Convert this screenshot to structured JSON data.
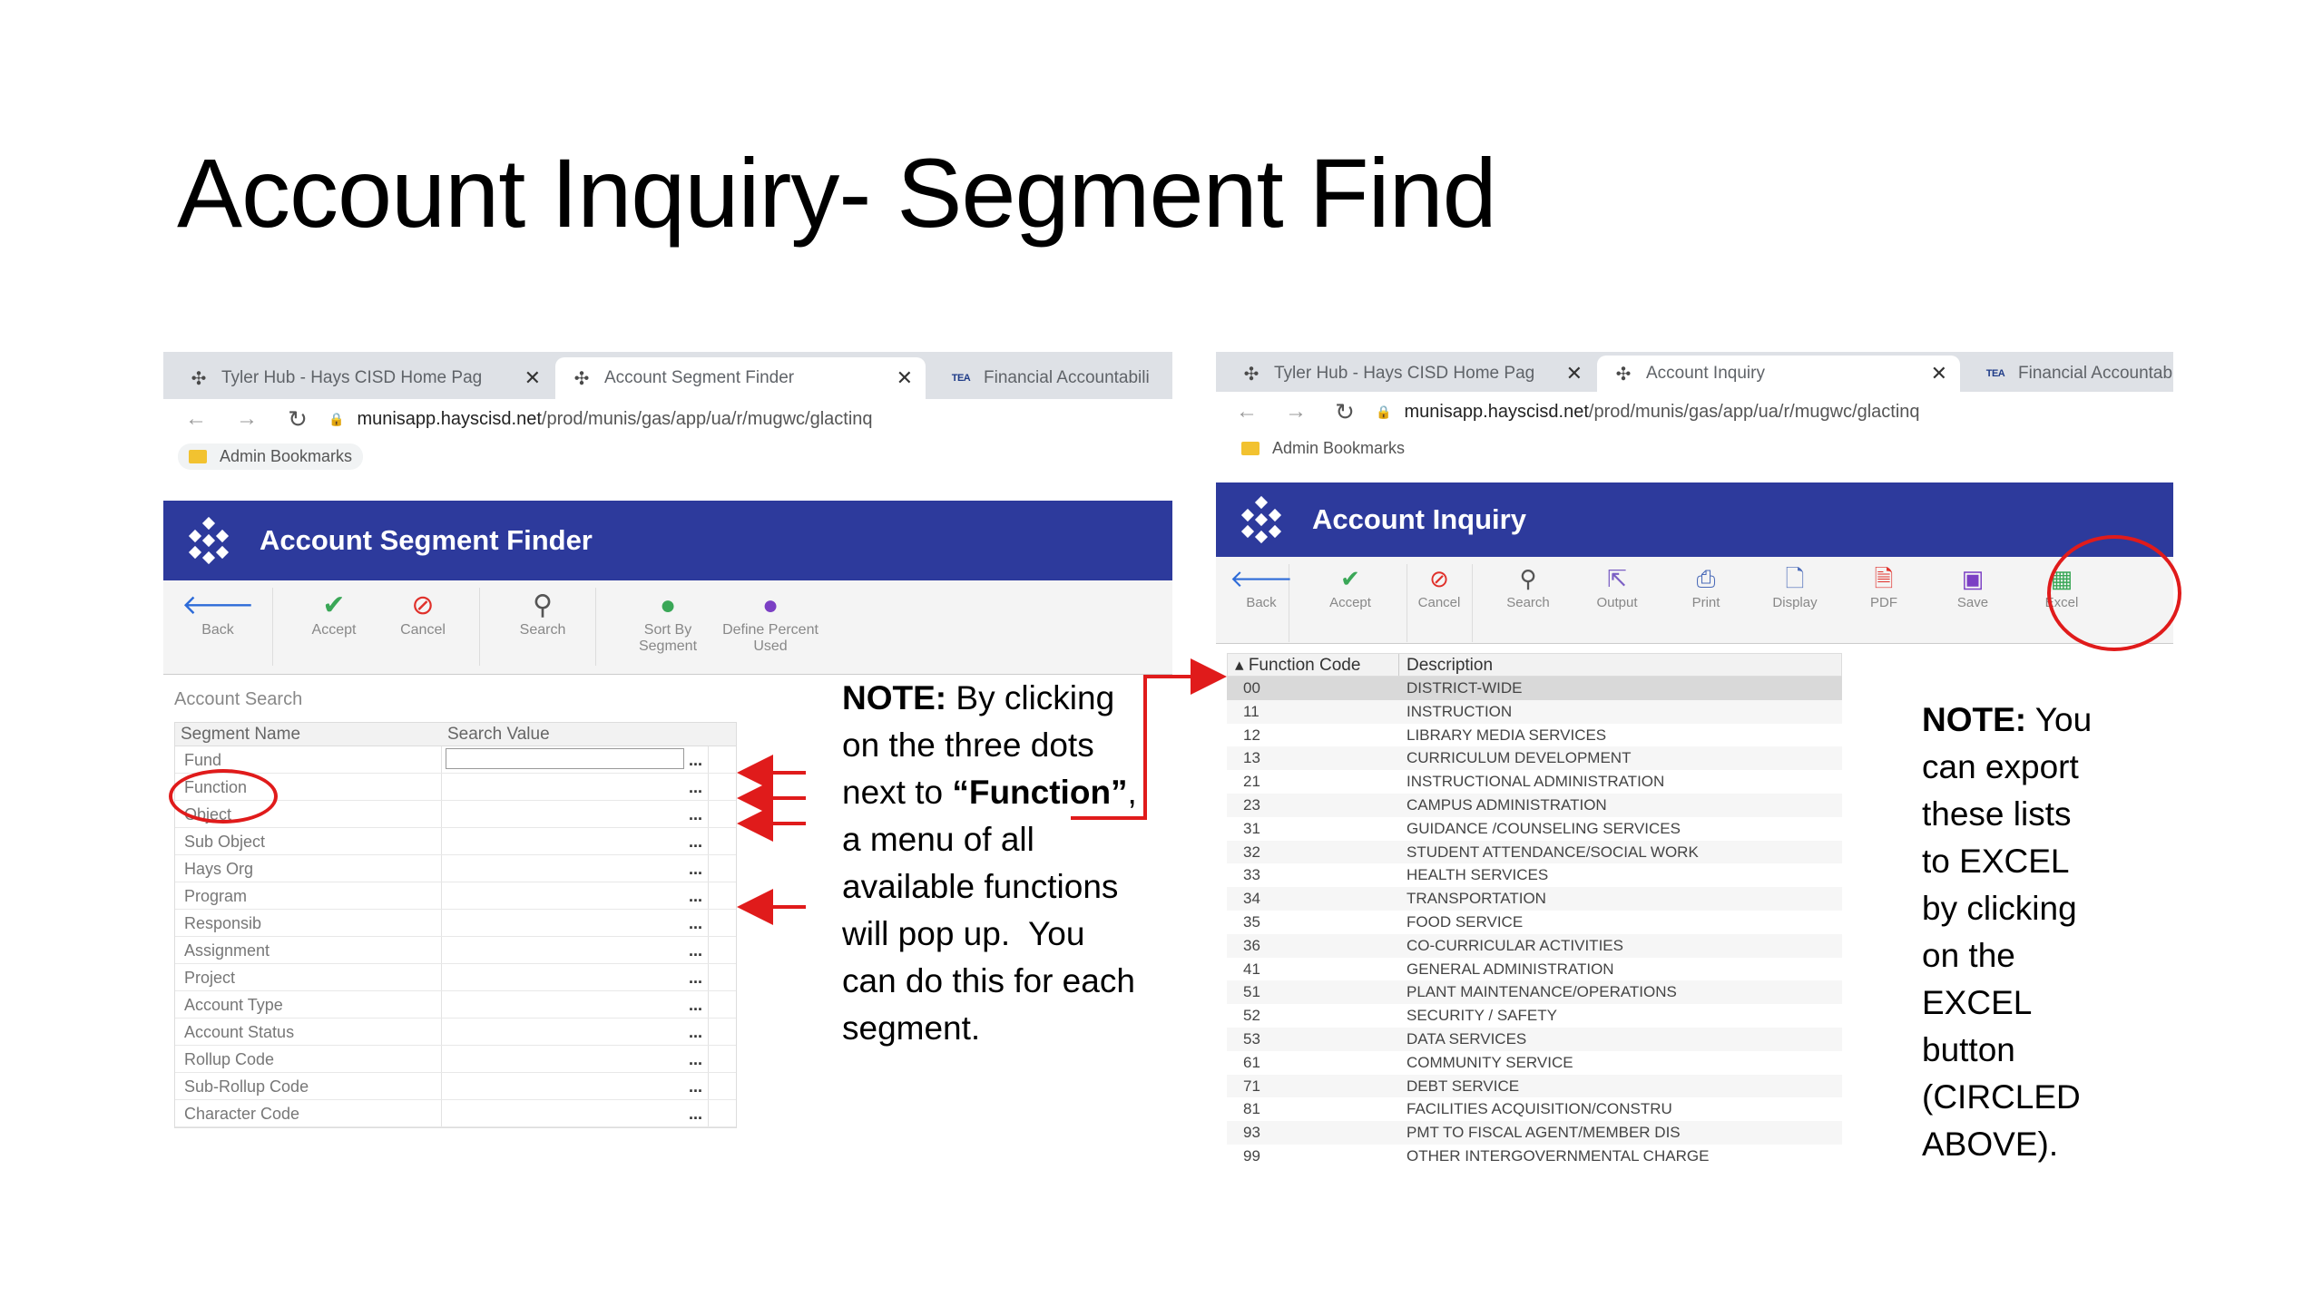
{
  "slide": {
    "title": "Account Inquiry- Segment Find"
  },
  "left_screenshot": {
    "tabs": [
      {
        "label": "Tyler Hub - Hays CISD Home Pag",
        "icon": "tyler-logo-icon"
      },
      {
        "label": "Account Segment Finder",
        "icon": "tyler-logo-icon"
      },
      {
        "label": "Financial Accountabili",
        "icon": "tea-logo-icon",
        "badge": "TEA"
      }
    ],
    "url": {
      "host": "munisapp.hayscisd.net",
      "path": "/prod/munis/gas/app/ua/r/mugwc/glactinq"
    },
    "bookmark": "Admin Bookmarks",
    "app_title": "Account Segment Finder",
    "toolbar": [
      {
        "label": "Back",
        "icon": "back-arrow-icon",
        "color": "#2d6bd8"
      },
      {
        "label": "Accept",
        "icon": "check-icon",
        "color": "#3aa757"
      },
      {
        "label": "Cancel",
        "icon": "cancel-icon",
        "color": "#e0302a"
      },
      {
        "label": "Search",
        "icon": "search-icon",
        "color": "#555555"
      },
      {
        "label": "Sort By Segment",
        "icon": "sort-icon",
        "color": "#3aa757"
      },
      {
        "label": "Define Percent Used",
        "icon": "define-icon",
        "color": "#7b3fc4"
      }
    ],
    "section_label": "Account Search",
    "columns": [
      "Segment Name",
      "Search Value"
    ],
    "segments": [
      "Fund",
      "Function",
      "Object",
      "Sub Object",
      "Hays Org",
      "Program",
      "Responsib",
      "Assignment",
      "Project",
      "Account Type",
      "Account Status",
      "Rollup Code",
      "Sub-Rollup Code",
      "Character Code"
    ],
    "dots": "..."
  },
  "right_screenshot": {
    "tabs": [
      {
        "label": "Tyler Hub - Hays CISD Home Pag",
        "icon": "tyler-logo-icon"
      },
      {
        "label": "Account Inquiry",
        "icon": "tyler-logo-icon"
      },
      {
        "label": "Financial Accountabilit",
        "icon": "tea-logo-icon",
        "badge": "TEA"
      }
    ],
    "url": {
      "host": "munisapp.hayscisd.net",
      "path": "/prod/munis/gas/app/ua/r/mugwc/glactinq"
    },
    "bookmark": "Admin Bookmarks",
    "app_title": "Account Inquiry",
    "toolbar": [
      {
        "label": "Back",
        "icon": "back-arrow-icon",
        "color": "#2d6bd8"
      },
      {
        "label": "Accept",
        "icon": "check-icon",
        "color": "#3aa757"
      },
      {
        "label": "Cancel",
        "icon": "cancel-icon",
        "color": "#e0302a"
      },
      {
        "label": "Search",
        "icon": "search-icon",
        "color": "#555555"
      },
      {
        "label": "Output",
        "icon": "output-icon",
        "color": "#7b5fc4"
      },
      {
        "label": "Print",
        "icon": "print-icon",
        "color": "#4a6ab8"
      },
      {
        "label": "Display",
        "icon": "display-icon",
        "color": "#4a6ab8"
      },
      {
        "label": "PDF",
        "icon": "pdf-icon",
        "color": "#e0302a"
      },
      {
        "label": "Save",
        "icon": "save-icon",
        "color": "#7b3fc4"
      },
      {
        "label": "Excel",
        "icon": "excel-icon",
        "color": "#3aa757"
      }
    ],
    "columns": [
      "Function Code",
      "Description"
    ],
    "functions": [
      {
        "code": "00",
        "desc": "DISTRICT-WIDE"
      },
      {
        "code": "11",
        "desc": "INSTRUCTION"
      },
      {
        "code": "12",
        "desc": "LIBRARY MEDIA SERVICES"
      },
      {
        "code": "13",
        "desc": "CURRICULUM DEVELOPMENT"
      },
      {
        "code": "21",
        "desc": "INSTRUCTIONAL ADMINISTRATION"
      },
      {
        "code": "23",
        "desc": "CAMPUS ADMINISTRATION"
      },
      {
        "code": "31",
        "desc": "GUIDANCE /COUNSELING SERVICES"
      },
      {
        "code": "32",
        "desc": "STUDENT ATTENDANCE/SOCIAL WORK"
      },
      {
        "code": "33",
        "desc": "HEALTH SERVICES"
      },
      {
        "code": "34",
        "desc": "TRANSPORTATION"
      },
      {
        "code": "35",
        "desc": "FOOD SERVICE"
      },
      {
        "code": "36",
        "desc": "CO-CURRICULAR ACTIVITIES"
      },
      {
        "code": "41",
        "desc": "GENERAL ADMINISTRATION"
      },
      {
        "code": "51",
        "desc": "PLANT MAINTENANCE/OPERATIONS"
      },
      {
        "code": "52",
        "desc": "SECURITY / SAFETY"
      },
      {
        "code": "53",
        "desc": "DATA SERVICES"
      },
      {
        "code": "61",
        "desc": "COMMUNITY SERVICE"
      },
      {
        "code": "71",
        "desc": "DEBT SERVICE"
      },
      {
        "code": "81",
        "desc": "FACILITIES ACQUISITION/CONSTRU"
      },
      {
        "code": "93",
        "desc": "PMT TO FISCAL AGENT/MEMBER DIS"
      },
      {
        "code": "99",
        "desc": "OTHER INTERGOVERNMENTAL CHARGE"
      }
    ]
  },
  "note_left": {
    "lines": [
      [
        {
          "t": "NOTE:",
          "b": true
        },
        {
          "t": " By clicking",
          "b": false
        }
      ],
      [
        {
          "t": "on the three dots",
          "b": false
        }
      ],
      [
        {
          "t": "next to ",
          "b": false
        },
        {
          "t": "“Function”",
          "b": true
        },
        {
          "t": ",",
          "b": false
        }
      ],
      [
        {
          "t": "a menu of all",
          "b": false
        }
      ],
      [
        {
          "t": "available functions",
          "b": false
        }
      ],
      [
        {
          "t": "will pop up.  You",
          "b": false
        }
      ],
      [
        {
          "t": "can do this for each",
          "b": false
        }
      ],
      [
        {
          "t": "segment.",
          "b": false
        }
      ]
    ]
  },
  "note_right": {
    "lines": [
      [
        {
          "t": "NOTE:",
          "b": true
        },
        {
          "t": " You",
          "b": false
        }
      ],
      [
        {
          "t": "can export",
          "b": false
        }
      ],
      [
        {
          "t": "these lists",
          "b": false
        }
      ],
      [
        {
          "t": "to EXCEL",
          "b": false
        }
      ],
      [
        {
          "t": "by clicking",
          "b": false
        }
      ],
      [
        {
          "t": "on the",
          "b": false
        }
      ],
      [
        {
          "t": "EXCEL",
          "b": false
        }
      ],
      [
        {
          "t": "button",
          "b": false
        }
      ],
      [
        {
          "t": "(CIRCLED",
          "b": false
        }
      ],
      [
        {
          "t": "ABOVE).",
          "b": false
        }
      ]
    ]
  },
  "colors": {
    "app_header": "#2d3a9c",
    "annotation_red": "#e01b1b"
  }
}
